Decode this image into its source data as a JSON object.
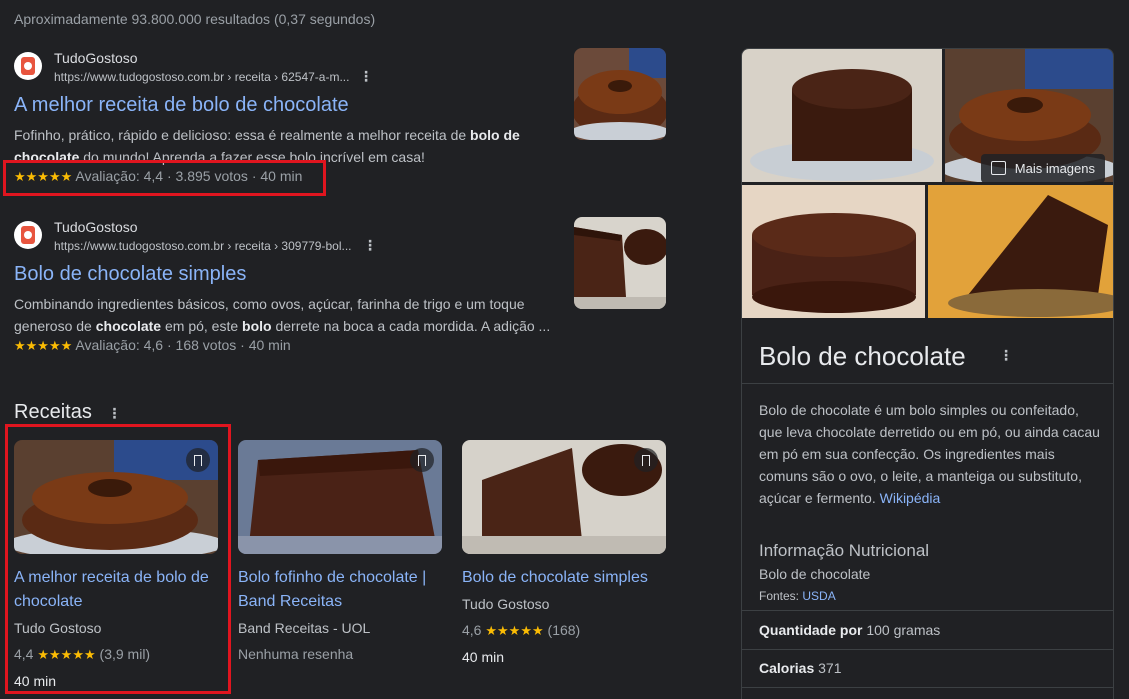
{
  "results_stats": "Aproximadamente 93.800.000 resultados (0,37 segundos)",
  "results": [
    {
      "site_name": "TudoGostoso",
      "url": "https://www.tudogostoso.com.br › receita › 62547-a-m...",
      "title": "A melhor receita de bolo de chocolate",
      "snippet_parts": [
        "Fofinho, prático, rápido e delicioso: essa é realmente a melhor receita de ",
        "bolo de chocolate",
        " do mundo! Aprenda a fazer esse bolo incrível em casa!"
      ],
      "stars": "★★★★★",
      "rating_text": "Avaliação: 4,4 · 3.895 votos · 40 min"
    },
    {
      "site_name": "TudoGostoso",
      "url": "https://www.tudogostoso.com.br › receita › 309779-bol...",
      "title": "Bolo de chocolate simples",
      "snippet_parts": [
        "Combinando ingredientes básicos, como ovos, açúcar, farinha de trigo e um toque generoso de ",
        "chocolate",
        " em pó, este ",
        "bolo",
        " derrete na boca a cada mordida. A adição ..."
      ],
      "stars": "★★★★★",
      "rating_text": "Avaliação: 4,6 · 168 votos · 40 min"
    }
  ],
  "recipes": {
    "heading": "Receitas",
    "cards": [
      {
        "title": "A melhor receita de bolo de chocolate",
        "source": "Tudo Gostoso",
        "rating": "4,4",
        "stars": "★★★★★",
        "count": "(3,9 mil)",
        "time": "40 min"
      },
      {
        "title": "Bolo fofinho de chocolate | Band Receitas",
        "source": "Band Receitas - UOL",
        "no_reviews": "Nenhuma resenha"
      },
      {
        "title": "Bolo de chocolate simples",
        "source": "Tudo Gostoso",
        "rating": "4,6",
        "stars": "★★★★★",
        "count": "(168)",
        "time": "40 min"
      }
    ]
  },
  "knowledge_panel": {
    "more_images": "Mais imagens",
    "title": "Bolo de chocolate",
    "description": "Bolo de chocolate é um bolo simples ou confeitado, que leva chocolate derretido ou em pó, ou ainda cacau em pó em sua confecção. Os ingredientes mais comuns são o ovo, o leite, a manteiga ou substituto, açúcar e fermento.",
    "wiki_link": "Wikipédia",
    "nutrition_heading": "Informação Nutricional",
    "nutrition_item": "Bolo de chocolate",
    "sources_label": "Fontes:",
    "sources_link": "USDA",
    "quantity_label": "Quantidade por",
    "quantity_value": "100 gramas",
    "calories_label": "Calorias",
    "calories_value": "371"
  }
}
